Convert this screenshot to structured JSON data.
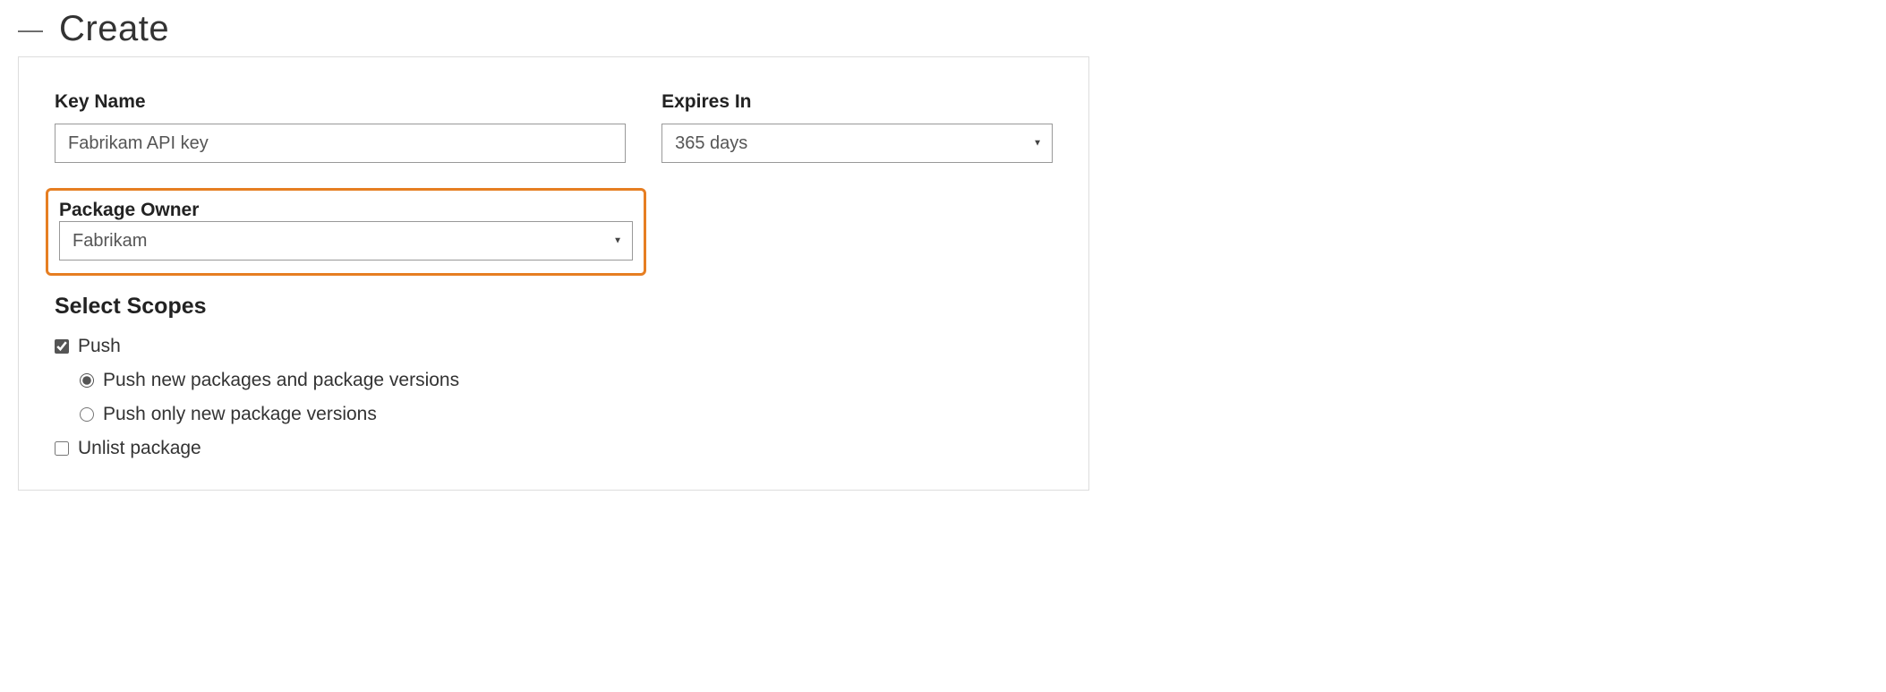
{
  "header": {
    "title": "Create"
  },
  "form": {
    "key_name": {
      "label": "Key Name",
      "value": "Fabrikam API key"
    },
    "expires_in": {
      "label": "Expires In",
      "value": "365 days"
    },
    "package_owner": {
      "label": "Package Owner",
      "value": "Fabrikam"
    },
    "scopes": {
      "heading": "Select Scopes",
      "push": {
        "label": "Push",
        "checked": true,
        "options": {
          "new_and_versions": {
            "label": "Push new packages and package versions",
            "selected": true
          },
          "versions_only": {
            "label": "Push only new package versions",
            "selected": false
          }
        }
      },
      "unlist": {
        "label": "Unlist package",
        "checked": false
      }
    }
  }
}
